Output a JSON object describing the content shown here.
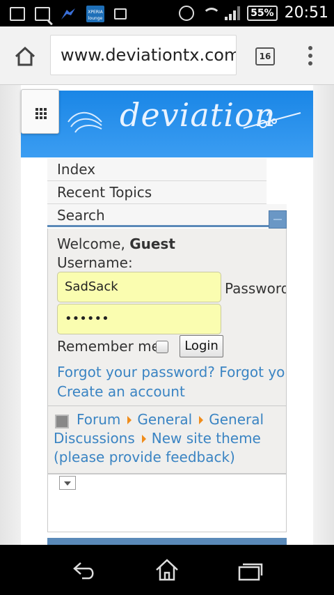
{
  "status_bar": {
    "battery": "55%",
    "time": "20:51",
    "xperia_badge": "XPERIA lounge"
  },
  "browser": {
    "url": "www.deviationtx.com",
    "tab_count": "16"
  },
  "site": {
    "logo": "deviation"
  },
  "nav": {
    "items": [
      {
        "label": "Index"
      },
      {
        "label": "Recent Topics"
      },
      {
        "label": "Search"
      }
    ]
  },
  "login": {
    "welcome_prefix": "Welcome, ",
    "welcome_user": "Guest",
    "username_label": "Username:",
    "username_value": "SadSack",
    "password_label": "Password",
    "password_value": "••••••",
    "remember_label": "Remember me",
    "login_button": "Login",
    "forgot_password": "Forgot your password?",
    "forgot_username": "Forgot your username?",
    "create_account": "Create an account"
  },
  "breadcrumb": {
    "items": [
      "Forum",
      "General",
      "General Discussions",
      "New site theme (please provide feedback)"
    ]
  }
}
